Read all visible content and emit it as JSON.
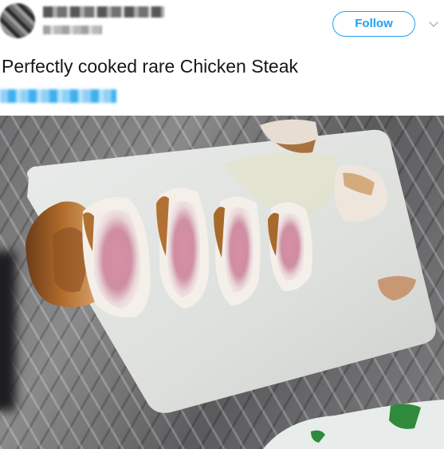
{
  "tweet": {
    "follow_label": "Follow",
    "text": "Perfectly cooked rare Chicken Steak"
  },
  "icons": {
    "menu": "chevron-down-icon"
  },
  "colors": {
    "accent": "#1da1f2",
    "text": "#14171a"
  }
}
